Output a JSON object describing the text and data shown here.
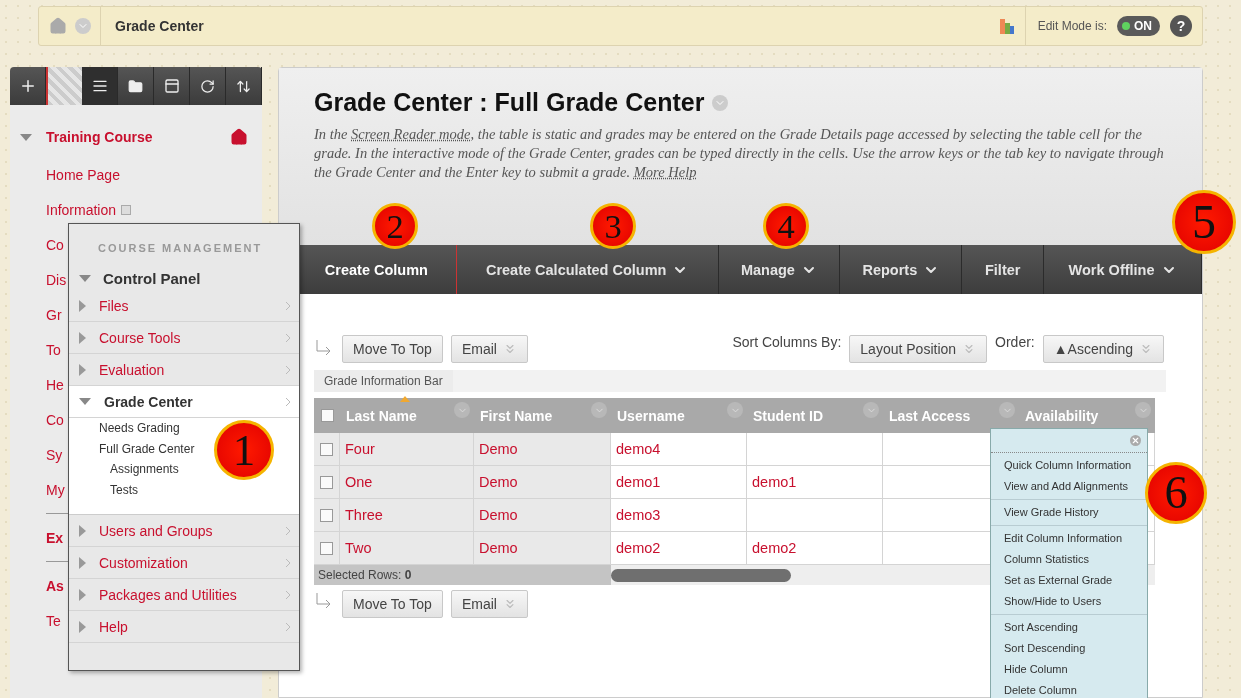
{
  "breadcrumb": {
    "title": "Grade Center"
  },
  "edit_mode": {
    "label": "Edit Mode is:",
    "toggle": "ON",
    "on": true,
    "help": "?"
  },
  "sidebar": {
    "course": {
      "title": "Training Course",
      "expanded": true
    },
    "items": [
      {
        "label": "Home Page",
        "kind": "link"
      },
      {
        "label": "Information",
        "kind": "link"
      },
      {
        "label": "Co",
        "kind": "link"
      },
      {
        "label": "Dis",
        "kind": "link"
      },
      {
        "label": "Gr",
        "kind": "link"
      },
      {
        "label": "To",
        "kind": "link"
      },
      {
        "label": "He",
        "kind": "link"
      },
      {
        "label": "Co",
        "kind": "link"
      },
      {
        "label": "Sy",
        "kind": "link"
      },
      {
        "label": "My",
        "kind": "link"
      },
      {
        "kind": "divider"
      },
      {
        "label": "Ex",
        "kind": "heading"
      },
      {
        "kind": "divider"
      },
      {
        "label": "As",
        "kind": "heading"
      },
      {
        "label": "Te",
        "kind": "link"
      }
    ]
  },
  "course_menu": {
    "heading": "COURSE MANAGEMENT",
    "title": "Control Panel",
    "expanded": true,
    "items": [
      {
        "label": "Files",
        "expanded": false
      },
      {
        "label": "Course Tools",
        "expanded": false
      },
      {
        "label": "Evaluation",
        "expanded": false
      },
      {
        "label": "Grade Center",
        "expanded": true,
        "children": [
          {
            "label": "Needs Grading"
          },
          {
            "label": "Full Grade Center",
            "children": [
              {
                "label": "Assignments"
              },
              {
                "label": "Tests"
              }
            ]
          }
        ]
      },
      {
        "label": "Users and Groups",
        "expanded": false
      },
      {
        "label": "Customization",
        "expanded": false
      },
      {
        "label": "Packages and Utilities",
        "expanded": false
      },
      {
        "label": "Help",
        "expanded": false
      }
    ]
  },
  "page": {
    "title": "Grade Center : Full Grade Center",
    "intro": "In the ",
    "link": "Screen Reader mode",
    "text": ", the table is static and grades may be entered on the Grade Details page accessed by selecting the table cell for the grade. In the interactive mode of the Grade Center, grades can be typed directly in the cells. Use the arrow keys or the tab key to navigate through the Grade Center and the Enter key to submit a grade. ",
    "help_link": "More Help"
  },
  "toolbar": [
    {
      "label": "Create Column",
      "menu": false
    },
    {
      "label": "Create Calculated Column",
      "menu": true
    },
    {
      "label": "Manage",
      "menu": true
    },
    {
      "label": "Reports",
      "menu": true
    },
    {
      "label": "Filter",
      "menu": false
    },
    {
      "label": "Work Offline",
      "menu": true
    }
  ],
  "actions_top": [
    {
      "label": "Move To Top",
      "menu": false
    },
    {
      "label": "Email",
      "menu": true
    }
  ],
  "sort": {
    "label": "Sort Columns By:",
    "value": "Layout Position"
  },
  "order": {
    "label": "Order:",
    "value": "▲Ascending"
  },
  "grade_info_bar": "Grade Information Bar",
  "table": {
    "select_all": false,
    "columns": [
      {
        "label": "Last Name",
        "sorted": true
      },
      {
        "label": "First Name",
        "sorted": false
      },
      {
        "label": "Username",
        "sorted": false
      },
      {
        "label": "Student ID",
        "sorted": false
      },
      {
        "label": "Last Access",
        "sorted": false
      },
      {
        "label": "Availability",
        "sorted": false
      }
    ],
    "rows": [
      {
        "checked": false,
        "last_name": "Four",
        "first_name": "Demo",
        "username": "demo4"
      },
      {
        "checked": false,
        "last_name": "One",
        "first_name": "Demo",
        "username": "demo1",
        "student_id": "demo1"
      },
      {
        "checked": false,
        "last_name": "Three",
        "first_name": "Demo",
        "username": "demo3"
      },
      {
        "checked": false,
        "last_name": "Two",
        "first_name": "Demo",
        "username": "demo2",
        "student_id": "demo2"
      }
    ]
  },
  "selected_rows": {
    "label": "Selected Rows:",
    "count": "0"
  },
  "actions_bottom": [
    {
      "label": "Move To Top",
      "menu": false
    },
    {
      "label": "Email",
      "menu": true
    }
  ],
  "column_menu": [
    [
      "Quick Column Information",
      "View and Add Alignments"
    ],
    [
      "View Grade History"
    ],
    [
      "Edit Column Information",
      "Column Statistics",
      "Set as External Grade",
      "Show/Hide to Users"
    ],
    [
      "Sort Ascending",
      "Sort Descending",
      "Hide Column",
      "Delete Column"
    ]
  ],
  "callouts": [
    "1",
    "2",
    "3",
    "4",
    "5",
    "6"
  ]
}
